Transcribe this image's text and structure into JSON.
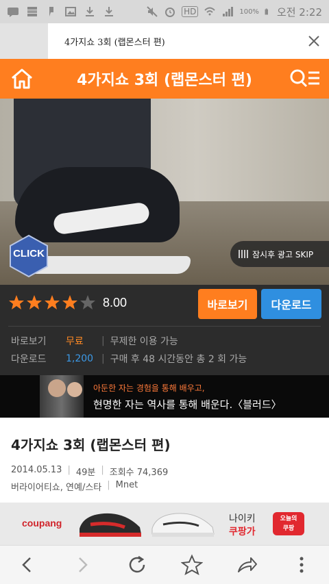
{
  "status_bar": {
    "battery": "100%",
    "time": "오전 2:22",
    "network": "HD"
  },
  "tab": {
    "title": "4가지쇼 3회 (랩몬스터 편)"
  },
  "header": {
    "title": "4가지쇼 3회 (랩몬스터 편)"
  },
  "video": {
    "click_label": "CLICK",
    "skip_label": "잠시후 광고 SKIP"
  },
  "rating": {
    "value": "8.00",
    "stars_filled": 4,
    "stars_total": 5
  },
  "buttons": {
    "watch": "바로보기",
    "download": "다운로드"
  },
  "pricing": [
    {
      "label": "바로보기",
      "price": "무료",
      "desc": "무제한 이용 가능"
    },
    {
      "label": "다운로드",
      "price": "1,200",
      "desc": "구매 후 48 시간동안 총 2 회 가능"
    }
  ],
  "banner": {
    "line1": "아둔한 자는 경험을 통해 배우고,",
    "line2": "현명한 자는 역사를 통해 배운다.〈블러드〉"
  },
  "content": {
    "title": "4가지쇼 3회 (랩몬스터 편)",
    "date": "2014.05.13",
    "duration": "49분",
    "views": "조회수 74,369",
    "genre": "버라이어티쇼, 연예/스타",
    "channel": "Mnet"
  },
  "ad": {
    "logo": "coupang",
    "line1": "나이키",
    "line2": "쿠팡가",
    "badge1": "오늘의",
    "badge2": "쿠팡"
  },
  "colors": {
    "accent": "#ff7e1f",
    "download": "#2f8fe0",
    "dark": "#2c2c2c"
  }
}
